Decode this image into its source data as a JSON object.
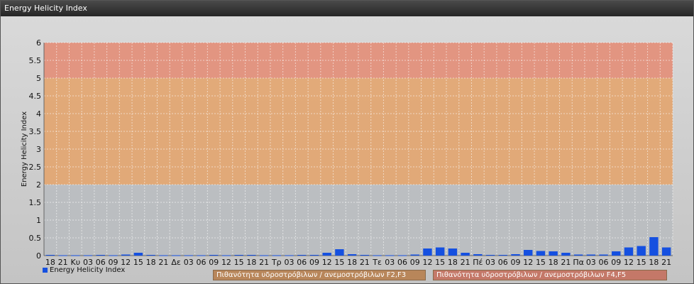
{
  "window": {
    "title": "Energy Helicity Index"
  },
  "chart_data": {
    "type": "bar",
    "title": "",
    "ylabel": "Energy Helicity Index",
    "ylim": [
      0,
      6
    ],
    "yticks": [
      "0",
      "0.5",
      "1",
      "1.5",
      "2",
      "2.5",
      "3",
      "3.5",
      "4",
      "4.5",
      "5",
      "5.5",
      "6"
    ],
    "categories": [
      "18",
      "21",
      "Κυ",
      "03",
      "06",
      "09",
      "12",
      "15",
      "18",
      "21",
      "Δε",
      "03",
      "06",
      "09",
      "12",
      "15",
      "18",
      "21",
      "Τρ",
      "03",
      "06",
      "09",
      "12",
      "15",
      "18",
      "21",
      "Τε",
      "03",
      "06",
      "09",
      "12",
      "15",
      "18",
      "21",
      "Πέ",
      "03",
      "06",
      "09",
      "12",
      "15",
      "18",
      "21",
      "Πα",
      "03",
      "06",
      "09",
      "12",
      "15",
      "18",
      "21"
    ],
    "series": [
      {
        "name": "Energy Helicity Index",
        "values": [
          0.02,
          0.01,
          0.01,
          0.01,
          0.02,
          0.01,
          0.03,
          0.08,
          0.02,
          0.01,
          0.01,
          0.01,
          0.01,
          0.02,
          0.01,
          0.02,
          0.02,
          0.01,
          0.01,
          0.01,
          0.02,
          0.02,
          0.08,
          0.18,
          0.04,
          0.02,
          0.01,
          0.01,
          0.01,
          0.03,
          0.2,
          0.23,
          0.2,
          0.08,
          0.04,
          0.02,
          0.02,
          0.04,
          0.16,
          0.13,
          0.12,
          0.08,
          0.03,
          0.03,
          0.03,
          0.12,
          0.23,
          0.27,
          0.52,
          0.23
        ],
        "color": "#1550e0"
      }
    ],
    "zones": [
      {
        "from": 0,
        "to": 2,
        "color": "#b8bcc0"
      },
      {
        "from": 2,
        "to": 5,
        "color": "#e4a268"
      },
      {
        "from": 5,
        "to": 6,
        "color": "#e48a72"
      }
    ],
    "zone_labels": [
      {
        "text": "Πιθανότητα υδροστρόβιλων / ανεμοστρόβιλων F2,F3",
        "color": "#b8865a"
      },
      {
        "text": "Πιθανότητα υδροστρόβιλων / ανεμοστρόβιλων F4,F5",
        "color": "#c47868"
      }
    ],
    "grid": true,
    "legend": "bottom-left"
  }
}
